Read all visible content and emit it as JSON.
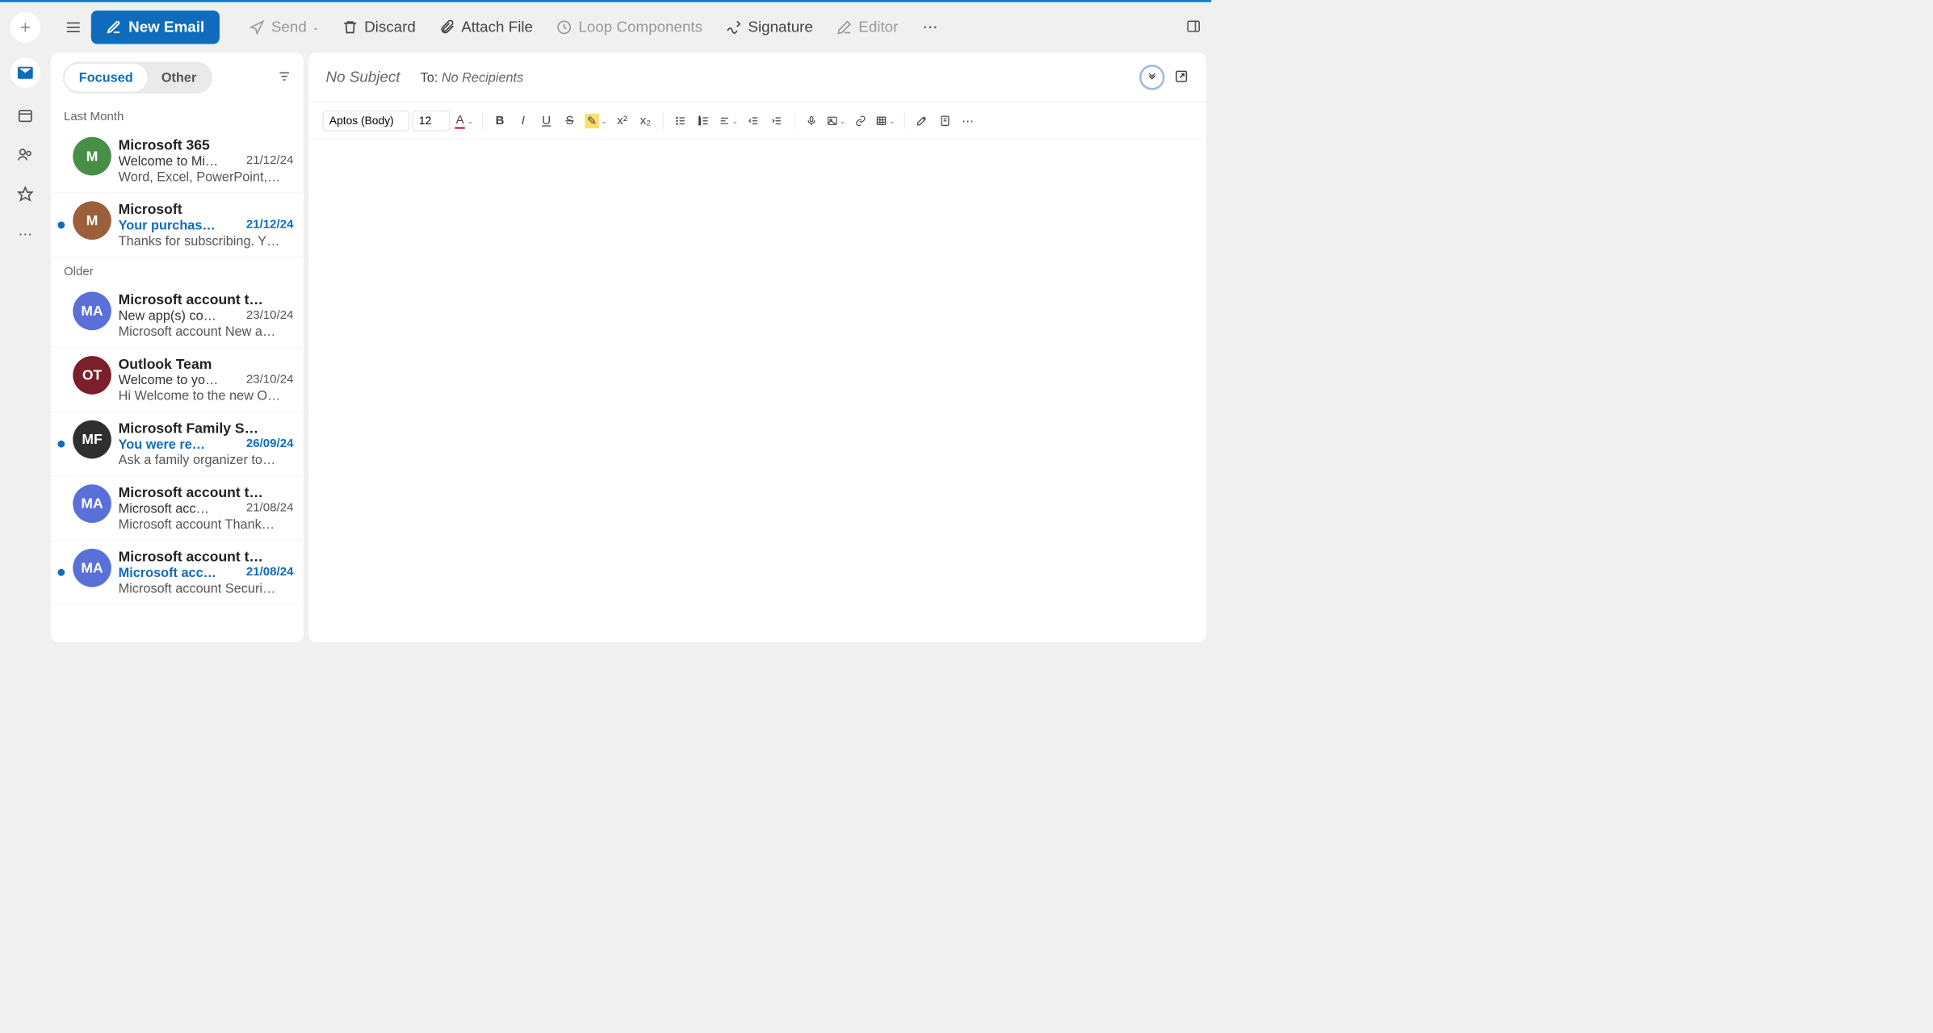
{
  "toolbar": {
    "new_email": "New Email",
    "send": "Send",
    "discard": "Discard",
    "attach": "Attach File",
    "loop": "Loop Components",
    "signature": "Signature",
    "editor": "Editor"
  },
  "tabs": {
    "focused": "Focused",
    "other": "Other"
  },
  "sections": {
    "last_month": "Last Month",
    "older": "Older"
  },
  "messages": [
    {
      "from": "Microsoft 365",
      "initials": "M",
      "color": "#478f47",
      "subject": "Welcome to Mi…",
      "date": "21/12/24",
      "preview": "Word, Excel, PowerPoint,…",
      "unread": false
    },
    {
      "from": "Microsoft",
      "initials": "M",
      "color": "#9b5f3a",
      "subject": "Your purchas…",
      "date": "21/12/24",
      "preview": "Thanks for subscribing. Y…",
      "unread": true
    },
    {
      "from": "Microsoft account t…",
      "initials": "MA",
      "color": "#5b6fd8",
      "subject": "New app(s) co…",
      "date": "23/10/24",
      "preview": "Microsoft account New a…",
      "unread": false
    },
    {
      "from": "Outlook Team",
      "initials": "OT",
      "color": "#7a1f2b",
      "subject": "Welcome to yo…",
      "date": "23/10/24",
      "preview": "Hi Welcome to the new O…",
      "unread": false
    },
    {
      "from": "Microsoft Family S…",
      "initials": "MF",
      "color": "#2f2f2f",
      "subject": "You were re…",
      "date": "26/09/24",
      "preview": "Ask a family organizer to…",
      "unread": true
    },
    {
      "from": "Microsoft account t…",
      "initials": "MA",
      "color": "#5b6fd8",
      "subject": "Microsoft acc…",
      "date": "21/08/24",
      "preview": "Microsoft account Thank…",
      "unread": false
    },
    {
      "from": "Microsoft account t…",
      "initials": "MA",
      "color": "#5b6fd8",
      "subject": "Microsoft acc…",
      "date": "21/08/24",
      "preview": "Microsoft account Securi…",
      "unread": true
    }
  ],
  "compose": {
    "subject": "No Subject",
    "to_label": "To:",
    "recipients": "No Recipients",
    "font": "Aptos (Body)",
    "size": "12"
  }
}
